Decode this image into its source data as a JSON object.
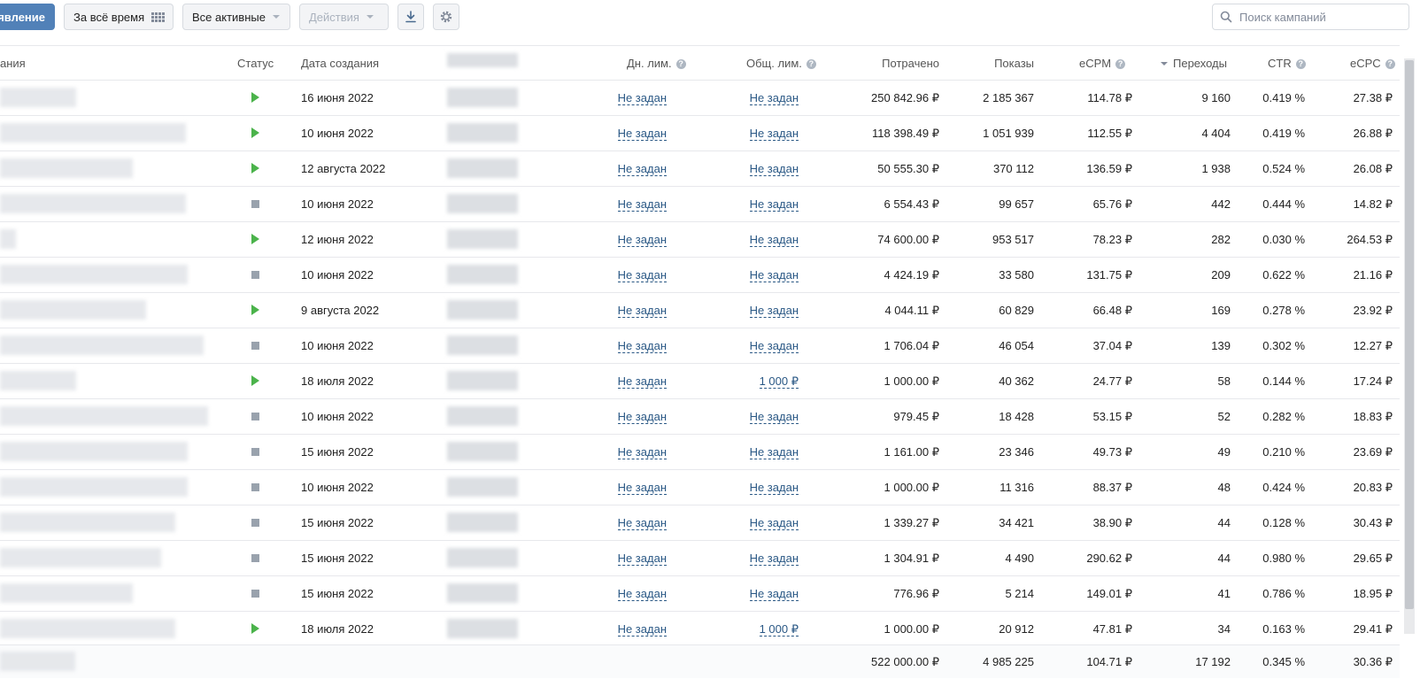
{
  "toolbar": {
    "create_button": "ъявление",
    "period_label": "За всё время",
    "filter_label": "Все активные",
    "actions_label": "Действия",
    "download_icon": "download-icon",
    "settings_icon": "gear-icon",
    "search_placeholder": "Поиск кампаний",
    "accent_color": "#5181b8"
  },
  "table": {
    "headers": {
      "name": "ания",
      "status": "Статус",
      "created": "Дата создания",
      "day_limit": "Дн. лим.",
      "total_limit": "Общ. лим.",
      "spent": "Потрачено",
      "impressions": "Показы",
      "ecpm": "eCPM",
      "clicks": "Переходы",
      "ctr": "CTR",
      "ecpc": "eCPC"
    },
    "rows": [
      {
        "status": "active",
        "created": "16 июня 2022",
        "day_limit": "Не задан",
        "total_limit": "Не задан",
        "spent": "250 842.96 ₽",
        "impressions": "2 185 367",
        "ecpm": "114.78 ₽",
        "clicks": "9 160",
        "ctr": "0.419 %",
        "ecpc": "27.38 ₽"
      },
      {
        "status": "active",
        "created": "10 июня 2022",
        "day_limit": "Не задан",
        "total_limit": "Не задан",
        "spent": "118 398.49 ₽",
        "impressions": "1 051 939",
        "ecpm": "112.55 ₽",
        "clicks": "4 404",
        "ctr": "0.419 %",
        "ecpc": "26.88 ₽"
      },
      {
        "status": "active",
        "created": "12 августа 2022",
        "day_limit": "Не задан",
        "total_limit": "Не задан",
        "spent": "50 555.30 ₽",
        "impressions": "370 112",
        "ecpm": "136.59 ₽",
        "clicks": "1 938",
        "ctr": "0.524 %",
        "ecpc": "26.08 ₽"
      },
      {
        "status": "stopped",
        "created": "10 июня 2022",
        "day_limit": "Не задан",
        "total_limit": "Не задан",
        "spent": "6 554.43 ₽",
        "impressions": "99 657",
        "ecpm": "65.76 ₽",
        "clicks": "442",
        "ctr": "0.444 %",
        "ecpc": "14.82 ₽"
      },
      {
        "status": "active",
        "created": "12 июня 2022",
        "day_limit": "Не задан",
        "total_limit": "Не задан",
        "spent": "74 600.00 ₽",
        "impressions": "953 517",
        "ecpm": "78.23 ₽",
        "clicks": "282",
        "ctr": "0.030 %",
        "ecpc": "264.53 ₽"
      },
      {
        "status": "stopped",
        "created": "10 июня 2022",
        "day_limit": "Не задан",
        "total_limit": "Не задан",
        "spent": "4 424.19 ₽",
        "impressions": "33 580",
        "ecpm": "131.75 ₽",
        "clicks": "209",
        "ctr": "0.622 %",
        "ecpc": "21.16 ₽"
      },
      {
        "status": "active",
        "created": "9 августа 2022",
        "day_limit": "Не задан",
        "total_limit": "Не задан",
        "spent": "4 044.11 ₽",
        "impressions": "60 829",
        "ecpm": "66.48 ₽",
        "clicks": "169",
        "ctr": "0.278 %",
        "ecpc": "23.92 ₽"
      },
      {
        "status": "stopped",
        "created": "10 июня 2022",
        "day_limit": "Не задан",
        "total_limit": "Не задан",
        "spent": "1 706.04 ₽",
        "impressions": "46 054",
        "ecpm": "37.04 ₽",
        "clicks": "139",
        "ctr": "0.302 %",
        "ecpc": "12.27 ₽"
      },
      {
        "status": "active",
        "created": "18 июля 2022",
        "day_limit": "Не задан",
        "total_limit": "1 000 ₽",
        "spent": "1 000.00 ₽",
        "impressions": "40 362",
        "ecpm": "24.77 ₽",
        "clicks": "58",
        "ctr": "0.144 %",
        "ecpc": "17.24 ₽"
      },
      {
        "status": "stopped",
        "created": "10 июня 2022",
        "day_limit": "Не задан",
        "total_limit": "Не задан",
        "spent": "979.45 ₽",
        "impressions": "18 428",
        "ecpm": "53.15 ₽",
        "clicks": "52",
        "ctr": "0.282 %",
        "ecpc": "18.83 ₽"
      },
      {
        "status": "stopped",
        "created": "15 июня 2022",
        "day_limit": "Не задан",
        "total_limit": "Не задан",
        "spent": "1 161.00 ₽",
        "impressions": "23 346",
        "ecpm": "49.73 ₽",
        "clicks": "49",
        "ctr": "0.210 %",
        "ecpc": "23.69 ₽"
      },
      {
        "status": "stopped",
        "created": "10 июня 2022",
        "day_limit": "Не задан",
        "total_limit": "Не задан",
        "spent": "1 000.00 ₽",
        "impressions": "11 316",
        "ecpm": "88.37 ₽",
        "clicks": "48",
        "ctr": "0.424 %",
        "ecpc": "20.83 ₽"
      },
      {
        "status": "stopped",
        "created": "15 июня 2022",
        "day_limit": "Не задан",
        "total_limit": "Не задан",
        "spent": "1 339.27 ₽",
        "impressions": "34 421",
        "ecpm": "38.90 ₽",
        "clicks": "44",
        "ctr": "0.128 %",
        "ecpc": "30.43 ₽"
      },
      {
        "status": "stopped",
        "created": "15 июня 2022",
        "day_limit": "Не задан",
        "total_limit": "Не задан",
        "spent": "1 304.91 ₽",
        "impressions": "4 490",
        "ecpm": "290.62 ₽",
        "clicks": "44",
        "ctr": "0.980 %",
        "ecpc": "29.65 ₽"
      },
      {
        "status": "stopped",
        "created": "15 июня 2022",
        "day_limit": "Не задан",
        "total_limit": "Не задан",
        "spent": "776.96 ₽",
        "impressions": "5 214",
        "ecpm": "149.01 ₽",
        "clicks": "41",
        "ctr": "0.786 %",
        "ecpc": "18.95 ₽"
      },
      {
        "status": "active",
        "created": "18 июля 2022",
        "day_limit": "Не задан",
        "total_limit": "1 000 ₽",
        "spent": "1 000.00 ₽",
        "impressions": "20 912",
        "ecpm": "47.81 ₽",
        "clicks": "34",
        "ctr": "0.163 %",
        "ecpc": "29.41 ₽"
      }
    ],
    "totals": {
      "spent": "522 000.00 ₽",
      "impressions": "4 985 225",
      "ecpm": "104.71 ₽",
      "clicks": "17 192",
      "ctr": "0.345 %",
      "ecpc": "30.36 ₽"
    },
    "status_colors": {
      "active": "#4bb34b",
      "stopped": "#99a2ad"
    },
    "link_color": "#2a5885"
  }
}
